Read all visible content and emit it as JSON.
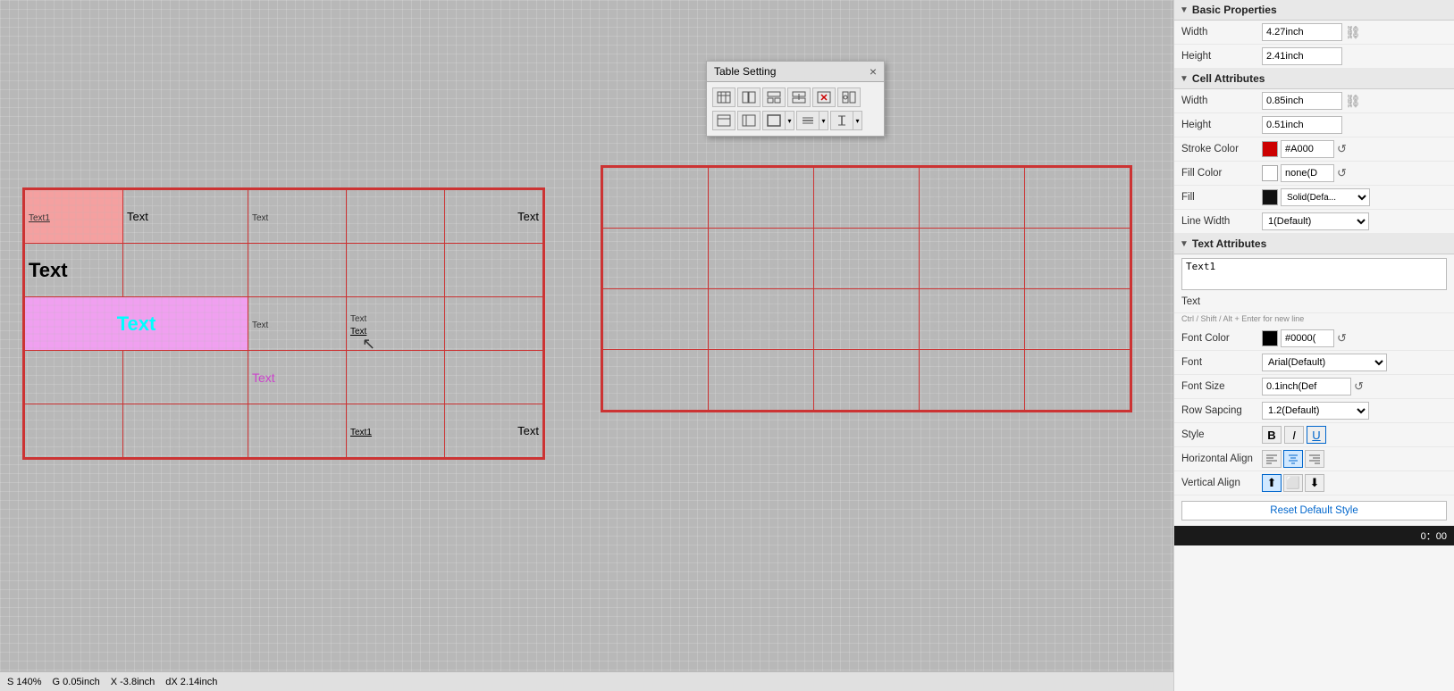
{
  "dialog": {
    "title": "Table Setting",
    "close_label": "×"
  },
  "left_table": {
    "cells": [
      {
        "row": 0,
        "col": 0,
        "text": "Text1",
        "style": "small-underline",
        "bg": "pink"
      },
      {
        "row": 0,
        "col": 1,
        "text": "Text",
        "style": "normal",
        "colspan": 2
      },
      {
        "row": 0,
        "col": 3,
        "text": "Text",
        "style": "small"
      },
      {
        "row": 0,
        "col": 4,
        "text": "Text",
        "style": "normal"
      },
      {
        "row": 1,
        "col": 0,
        "text": "Text",
        "style": "bold-large"
      },
      {
        "row": 2,
        "col": 0,
        "text": "Text",
        "style": "cyan-large",
        "bg": "violet",
        "colspan": 2
      },
      {
        "row": 2,
        "col": 2,
        "text": "Text",
        "style": "small"
      },
      {
        "row": 3,
        "col": 2,
        "text": "Text",
        "style": "magenta"
      },
      {
        "row": 4,
        "col": 3,
        "text": "Text1",
        "style": "small-underline"
      },
      {
        "row": 4,
        "col": 4,
        "text": "Text",
        "style": "normal"
      }
    ]
  },
  "right_panel": {
    "basic_properties": {
      "header": "Basic Properties",
      "width_label": "Width",
      "width_value": "4.27inch",
      "height_label": "Height",
      "height_value": "2.41inch"
    },
    "cell_attributes": {
      "header": "Cell Attributes",
      "width_label": "Width",
      "width_value": "0.85inch",
      "height_label": "Height",
      "height_value": "0.51inch",
      "stroke_color_label": "Stroke Color",
      "stroke_color_value": "#A000",
      "stroke_color_hex": "#cc0000",
      "fill_color_label": "Fill Color",
      "fill_color_value": "none(D",
      "fill_label": "Fill",
      "fill_value": "Solid(Defa...",
      "line_width_label": "Line Width",
      "line_width_value": "1(Default)"
    },
    "text_attributes": {
      "header": "Text Attributes",
      "text_value": "Text1",
      "text_label": "Text",
      "hint": "Ctrl / Shift / Alt + Enter for new line",
      "font_color_label": "Font Color",
      "font_color_hex": "#000000",
      "font_color_value": "#0000(",
      "font_label": "Font",
      "font_value": "Arial(Default)",
      "font_size_label": "Font Size",
      "font_size_value": "0.1inch(Def",
      "row_spacing_label": "Row Sapcing",
      "row_spacing_value": "1.2(Default)",
      "style_label": "Style",
      "style_bold": "B",
      "style_italic": "I",
      "style_underline": "U",
      "h_align_label": "Horizontal Align",
      "v_align_label": "Vertical Align",
      "reset_label": "Reset Default Style"
    }
  },
  "status_bar": {
    "scale": "S  140%",
    "g_label": "G  0.05inch",
    "x_label": "X  -3.8inch",
    "dx_label": "dX  2.14inch",
    "time": "0：00"
  }
}
